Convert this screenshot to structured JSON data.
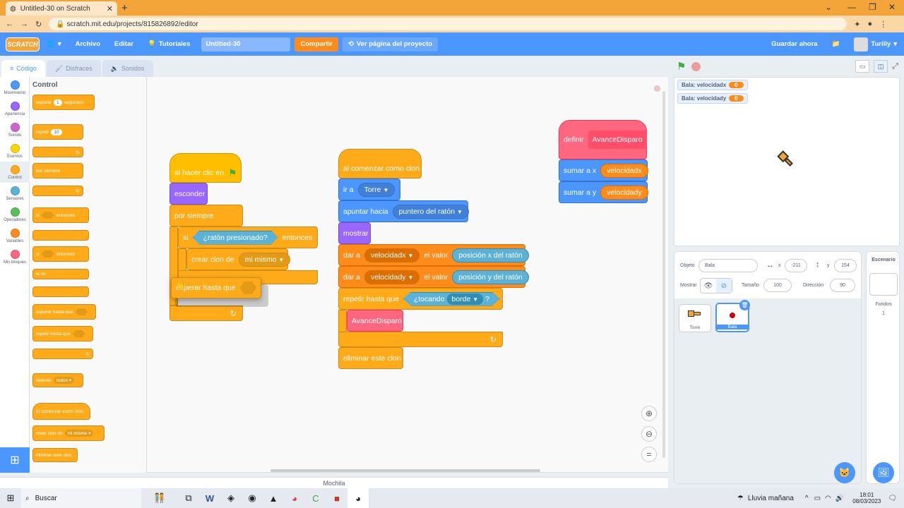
{
  "browser": {
    "tab_title": "Untitled-30 on Scratch",
    "url": "scratch.mit.edu/projects/815826892/editor"
  },
  "menu": {
    "logo": "SCRATCH",
    "file": "Archivo",
    "edit": "Editar",
    "tutorials": "Tutoriales",
    "project_title": "Untitled-30",
    "share": "Compartir",
    "see_project": "Ver página del proyecto",
    "save_now": "Guardar ahora",
    "user": "Turilly"
  },
  "editor_tabs": {
    "code": "Código",
    "costumes": "Disfraces",
    "sounds": "Sonidos"
  },
  "categories": [
    {
      "label": "Movimiento",
      "color": "#4c97ff"
    },
    {
      "label": "Apariencia",
      "color": "#9966ff"
    },
    {
      "label": "Sonido",
      "color": "#cf63cf"
    },
    {
      "label": "Eventos",
      "color": "#ffd500"
    },
    {
      "label": "Control",
      "color": "#ffab19"
    },
    {
      "label": "Sensores",
      "color": "#5cb1d6"
    },
    {
      "label": "Operadores",
      "color": "#59c059"
    },
    {
      "label": "Variables",
      "color": "#ff8c1a"
    },
    {
      "label": "Mis bloques",
      "color": "#ff6680"
    }
  ],
  "palette": {
    "title": "Control",
    "wait_pre": "esperar",
    "wait_val": "1",
    "wait_post": "segundos",
    "repeat": "repetir",
    "repeat_val": "10",
    "forever": "por siempre",
    "if": "si",
    "then": "entonces",
    "else": "si no",
    "wait_until": "esperar hasta que",
    "repeat_until": "repetir hasta que",
    "stop": "detener",
    "stop_val": "todos",
    "clone_start": "al comenzar como clon",
    "create_clone": "crear clon de",
    "create_clone_val": "mi mismo",
    "delete_clone": "eliminar este clon"
  },
  "script1": {
    "hat": "al hacer clic en",
    "hide": "esconder",
    "forever": "por siempre",
    "if": "si",
    "cond": "¿ratón presionado?",
    "then": "entonces",
    "create_clone": "crear clon de",
    "clone_of": "mi mismo",
    "dragged": "esperar hasta que"
  },
  "script2": {
    "hat": "al comenzar como clon",
    "goto": "ir a",
    "goto_val": "Torre",
    "point": "apuntar hacia",
    "point_val": "puntero del ratón",
    "show": "mostrar",
    "set1": "dar a",
    "set1_var": "velocidadx",
    "set1_mid": "el valor",
    "set1_val": "posición x del ratón",
    "set2": "dar a",
    "set2_var": "velocidady",
    "set2_mid": "el valor",
    "set2_val": "posición y del ratón",
    "repeat_until": "repetir hasta que",
    "touching": "¿tocando",
    "touching_val": "borde",
    "q": "?",
    "call": "AvanceDisparo",
    "delete": "eliminar este clon"
  },
  "script3": {
    "define": "definir",
    "name": "AvanceDisparo",
    "changex": "sumar a x",
    "vx": "velocidadx",
    "changey": "sumar a y",
    "vy": "velocidady"
  },
  "backpack": "Mochila",
  "monitors": [
    {
      "label": "Bala: velocidadx",
      "value": "0"
    },
    {
      "label": "Bala: velocidady",
      "value": "0"
    }
  ],
  "sprite_info": {
    "sprite_label": "Objeto",
    "sprite_name": "Bala",
    "x_label": "x",
    "x": "-211",
    "y_label": "y",
    "y": "154",
    "show_label": "Mostrar",
    "size_label": "Tamaño",
    "size": "100",
    "dir_label": "Dirección",
    "dir": "90"
  },
  "sprites": [
    {
      "name": "Torre"
    },
    {
      "name": "Bala"
    }
  ],
  "stage_panel": {
    "title": "Escenario",
    "backdrops": "Fondos",
    "count": "1"
  },
  "taskbar": {
    "search": "Buscar",
    "weather": "Lluvia mañana",
    "time": "18:01",
    "date": "08/03/2023"
  }
}
